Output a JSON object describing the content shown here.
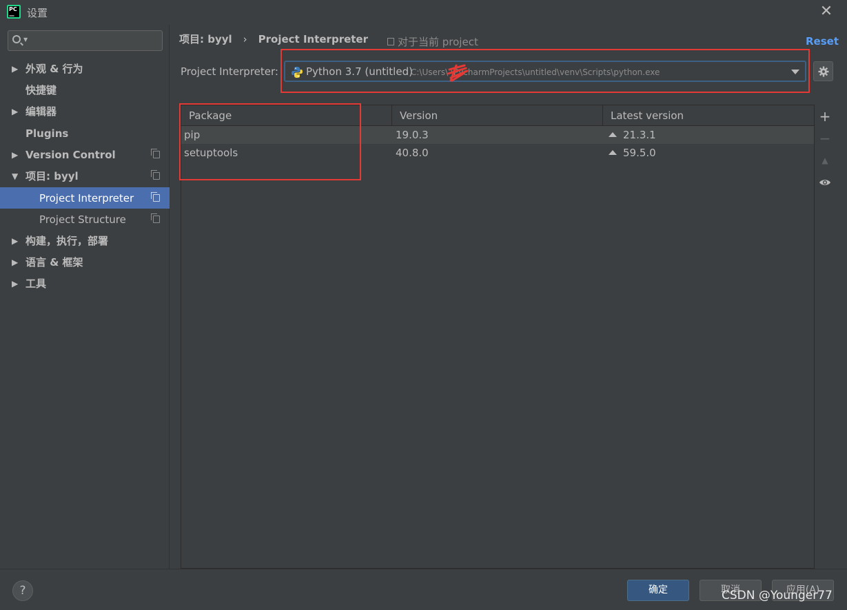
{
  "window": {
    "title": "设置",
    "logo_text_line1": "PC",
    "logo_text_line2": "—"
  },
  "sidebar": {
    "search_placeholder": "",
    "items": [
      {
        "label": "外观 & 行为",
        "arrow": "▶"
      },
      {
        "label": "快捷键"
      },
      {
        "label": "编辑器",
        "arrow": "▶"
      },
      {
        "label": "Plugins"
      },
      {
        "label": "Version Control",
        "arrow": "▶"
      },
      {
        "label": "项目: byyl",
        "arrow": "▼"
      },
      {
        "label": "Project Interpreter"
      },
      {
        "label": "Project Structure"
      },
      {
        "label": "构建，执行，部署",
        "arrow": "▶"
      },
      {
        "label": "语言 & 框架",
        "arrow": "▶"
      },
      {
        "label": "工具",
        "arrow": "▶"
      }
    ]
  },
  "main": {
    "breadcrumb": {
      "project": "项目: byyl",
      "separator": "›",
      "page": "Project Interpreter"
    },
    "scope_note": "对于当前 project",
    "reset_label": "Reset",
    "interpreter_label": "Project Interpreter:",
    "interpreter": {
      "name": "Python 3.7 (untitled)",
      "path": "C:\\Users\\      \\PycharmProjects\\untitled\\venv\\Scripts\\python.exe"
    },
    "table": {
      "columns": [
        "Package",
        "Version",
        "Latest version"
      ],
      "rows": [
        {
          "package": "pip",
          "version": "19.0.3",
          "latest": "21.3.1"
        },
        {
          "package": "setuptools",
          "version": "40.8.0",
          "latest": "59.5.0"
        }
      ]
    },
    "tools": {
      "add": "+",
      "remove": "−",
      "upgrade": "▲"
    }
  },
  "footer": {
    "help": "?",
    "ok": "确定",
    "cancel": "取消",
    "apply": "应用(A)",
    "watermark": "CSDN @Younger77"
  },
  "colors": {
    "background": "#3c3f41",
    "selection": "#4b6eaf",
    "link": "#589df6",
    "annotation_red": "#e53935",
    "ok_button": "#365880"
  }
}
